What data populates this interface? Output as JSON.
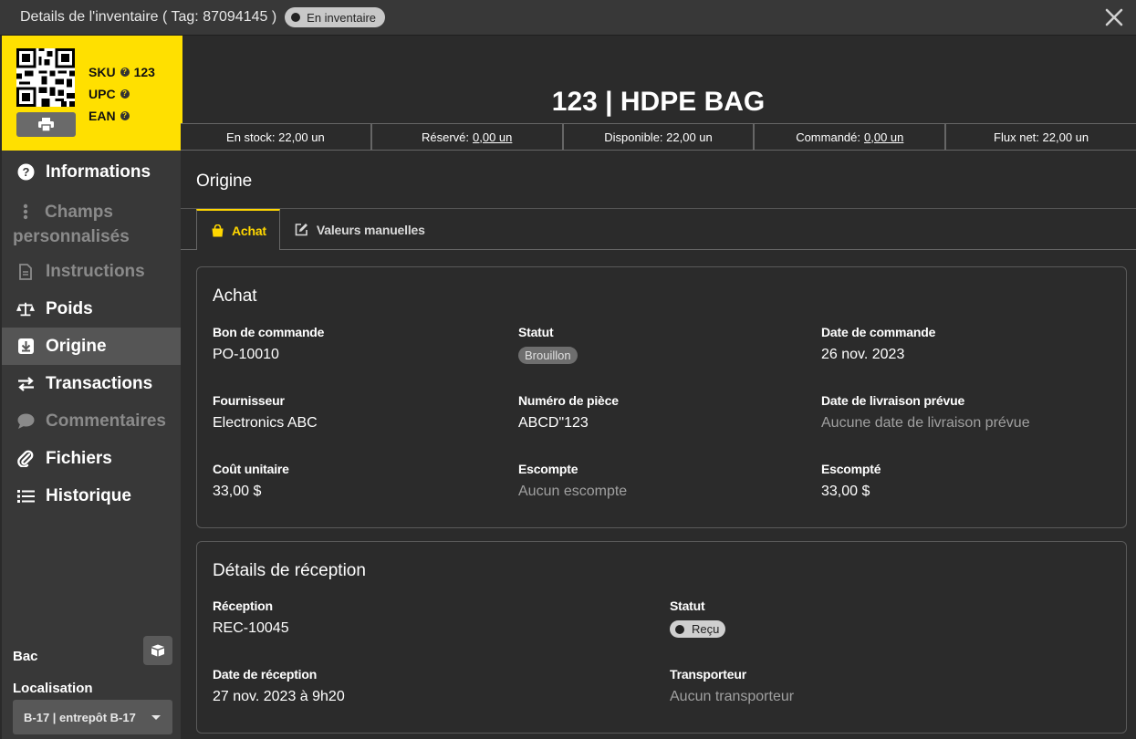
{
  "window": {
    "title": "Details de l'inventaire ( Tag: 87094145 )",
    "status_badge": "En inventaire"
  },
  "identity": {
    "sku_label": "SKU",
    "sku_value": "123",
    "upc_label": "UPC",
    "ean_label": "EAN"
  },
  "nav": {
    "informations": "Informations",
    "champs": "Champs personnalisés",
    "instructions": "Instructions",
    "poids": "Poids",
    "origine": "Origine",
    "transactions": "Transactions",
    "commentaires": "Commentaires",
    "fichiers": "Fichiers",
    "historique": "Historique"
  },
  "location": {
    "bac_label": "Bac",
    "localisation_label": "Localisation",
    "selected": "B-17 | entrepôt B-17"
  },
  "product": {
    "title": "123 | HDPE BAG"
  },
  "stock": {
    "en_stock": "En stock: 22,00 un",
    "reserve_label": "Réservé:",
    "reserve_value": "0,00 un",
    "disponible": "Disponible: 22,00 un",
    "commande_label": "Commandé:",
    "commande_value": "0,00 un",
    "flux_net": "Flux net: 22,00 un"
  },
  "section": {
    "title": "Origine",
    "tab_achat": "Achat",
    "tab_valeurs": "Valeurs manuelles"
  },
  "achat": {
    "title": "Achat",
    "bon_label": "Bon de commande",
    "bon_value": "PO-10010",
    "statut_label": "Statut",
    "statut_value": "Brouillon",
    "date_cmd_label": "Date de commande",
    "date_cmd_value": "26 nov. 2023",
    "fournisseur_label": "Fournisseur",
    "fournisseur_value": "Electronics ABC",
    "piece_label": "Numéro de pièce",
    "piece_value": "ABCD\"123",
    "livraison_label": "Date de livraison prévue",
    "livraison_value": "Aucune date de livraison prévue",
    "cout_label": "Coût unitaire",
    "cout_value": "33,00 $",
    "escompte_label": "Escompte",
    "escompte_value": "Aucun escompte",
    "escompte2_label": "Escompté",
    "escompte2_value": "33,00 $"
  },
  "reception": {
    "title": "Détails de réception",
    "recep_label": "Réception",
    "recep_value": "REC-10045",
    "statut_label": "Statut",
    "statut_value": "Reçu",
    "date_label": "Date de réception",
    "date_value": "27 nov. 2023 à 9h20",
    "transporteur_label": "Transporteur",
    "transporteur_value": "Aucun transporteur"
  }
}
